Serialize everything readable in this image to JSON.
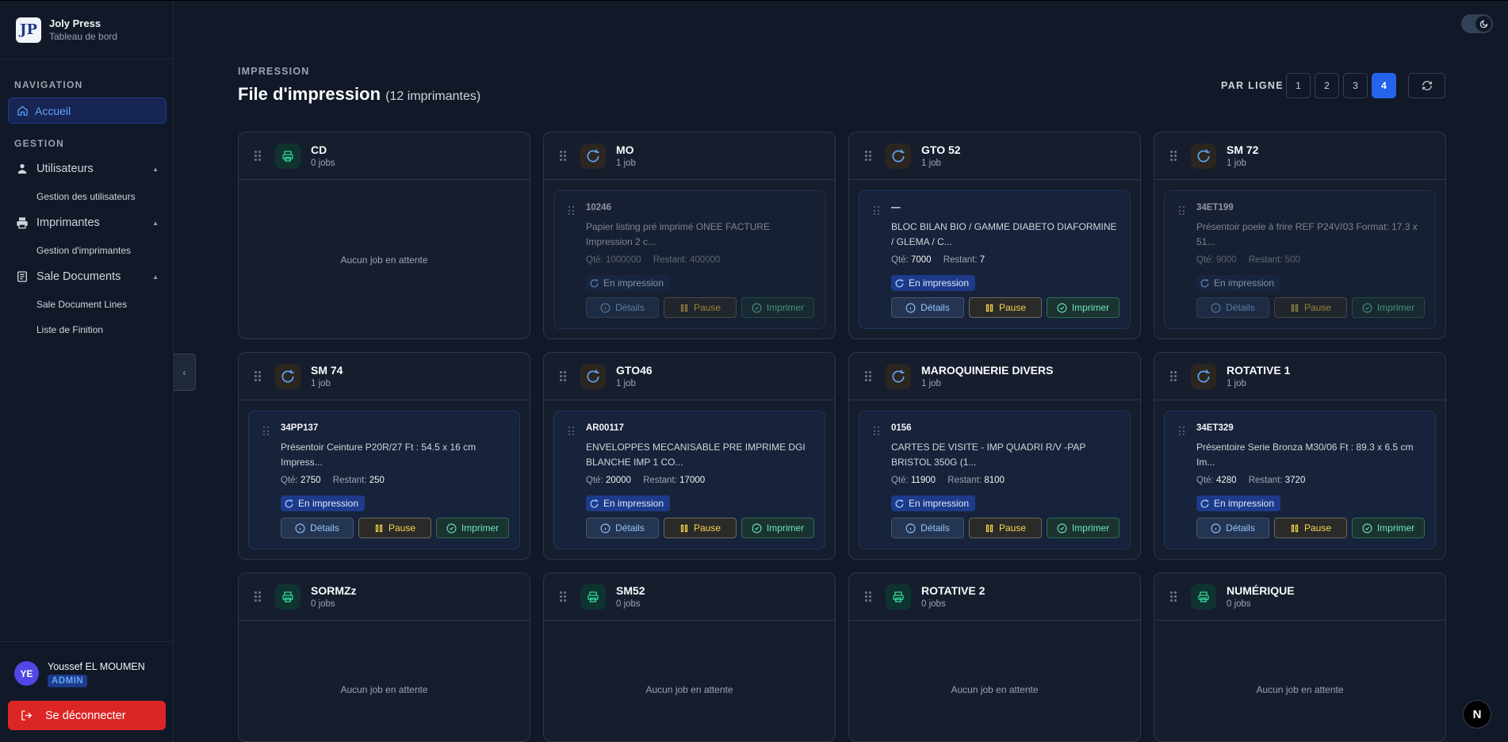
{
  "brand": {
    "name": "Joly Press",
    "subtitle": "Tableau de bord",
    "logo_text": "JP"
  },
  "nav": {
    "section_navigation": "NAVIGATION",
    "home": "Accueil",
    "section_gestion": "GESTION",
    "groups": [
      {
        "label": "Utilisateurs",
        "sub": "Gestion des utilisateurs"
      },
      {
        "label": "Imprimantes",
        "sub": "Gestion d'imprimantes"
      },
      {
        "label": "Sale Documents",
        "subs": [
          "Sale Document Lines",
          "Liste de Finition"
        ]
      }
    ]
  },
  "user": {
    "initials": "YE",
    "name": "Youssef EL MOUMEN",
    "role": "ADMIN",
    "logout": "Se déconnecter"
  },
  "header": {
    "eyebrow": "IMPRESSION",
    "title": "File d'impression",
    "count": "(12 imprimantes)",
    "per_line_label": "PAR LIGNE",
    "per_line_options": [
      "1",
      "2",
      "3",
      "4"
    ],
    "per_line_selected": "4"
  },
  "labels": {
    "empty": "Aucun job en attente",
    "qty": "Qté:",
    "remaining": "Restant:",
    "status": "En impression",
    "details": "Détails",
    "pause": "Pause",
    "print": "Imprimer"
  },
  "printers": [
    {
      "name": "CD",
      "jobs": "0 jobs"
    },
    {
      "name": "MO",
      "jobs": "1 job",
      "job": {
        "ref": "10246",
        "desc": "Papier listing pré imprimé ONEE FACTURE Impression 2 c...",
        "qty": "1000000",
        "remaining": "400000"
      }
    },
    {
      "name": "GTO 52",
      "jobs": "1 job",
      "job": {
        "ref": "—",
        "desc": "BLOC BILAN BIO / GAMME DIABETO DIAFORMINE / GLEMA / C...",
        "qty": "7000",
        "remaining": "7"
      }
    },
    {
      "name": "SM 72",
      "jobs": "1 job",
      "job": {
        "ref": "34ET199",
        "desc": "Présentoir poele à frire REF P24V/03 Format: 17.3 x 51...",
        "qty": "9000",
        "remaining": "500"
      }
    },
    {
      "name": "SM 74",
      "jobs": "1 job",
      "job": {
        "ref": "34PP137",
        "desc": "Présentoir Ceinture P20R/27 Ft : 54.5 x 16 cm Impress...",
        "qty": "2750",
        "remaining": "250"
      }
    },
    {
      "name": "GTO46",
      "jobs": "1 job",
      "job": {
        "ref": "AR00117",
        "desc": "ENVELOPPES MECANISABLE PRE IMPRIME DGI BLANCHE IMP 1 CO...",
        "qty": "20000",
        "remaining": "17000"
      }
    },
    {
      "name": "MAROQUINERIE DIVERS",
      "jobs": "1 job",
      "job": {
        "ref": "0156",
        "desc": "CARTES DE VISITE - IMP QUADRI R/V -PAP BRISTOL 350G (1...",
        "qty": "11900",
        "remaining": "8100"
      }
    },
    {
      "name": "ROTATIVE 1",
      "jobs": "1 job",
      "job": {
        "ref": "34ET329",
        "desc": "Présentoire Serie Bronza M30/06 Ft : 89.3 x 6.5 cm Im...",
        "qty": "4280",
        "remaining": "3720"
      }
    },
    {
      "name": "SORMZz",
      "jobs": "0 jobs"
    },
    {
      "name": "SM52",
      "jobs": "0 jobs"
    },
    {
      "name": "ROTATIVE 2",
      "jobs": "0 jobs"
    },
    {
      "name": "NUMÉRIQUE",
      "jobs": "0 jobs"
    }
  ],
  "badge": "N",
  "colors": {
    "accent": "#2563eb",
    "danger": "#dc2626",
    "pause": "#fcd34d",
    "print": "#6ee7b7",
    "status": "#1e3a8a"
  },
  "icons": {
    "printer_idle": "printer-icon",
    "printer_busy": "refresh-spinner-icon",
    "details": "info-icon",
    "pause": "pause-icon",
    "print": "check-circle-icon",
    "theme": "moon-icon"
  }
}
